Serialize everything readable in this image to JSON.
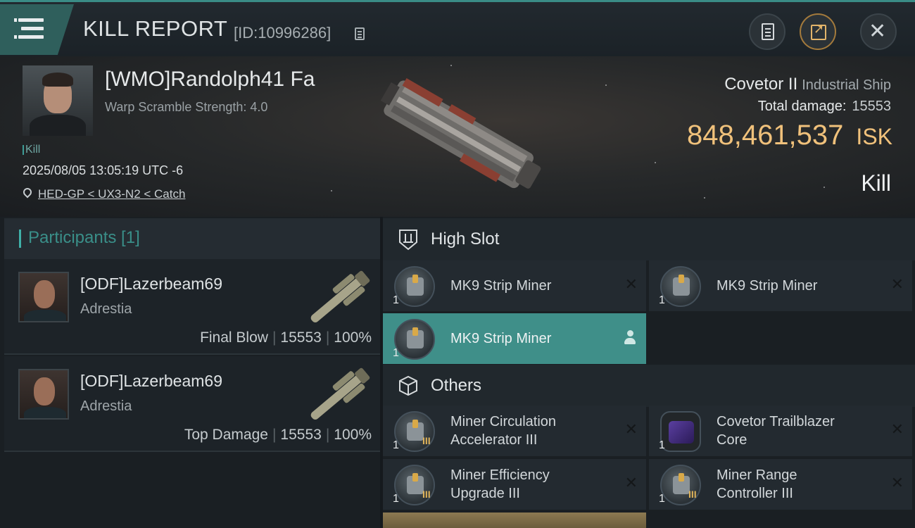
{
  "header": {
    "title": "KILL REPORT",
    "report_id": "[ID:10996286]",
    "icons": [
      "menu-icon",
      "copy-icon",
      "clipboard-icon",
      "share-icon",
      "close-icon"
    ]
  },
  "victim": {
    "name": "[WMO]Randolph41 Fa",
    "warp_scramble": "Warp Scramble Strength: 4.0",
    "tag": "Kill",
    "timestamp": "2025/08/05 13:05:19 UTC -6",
    "location": "HED-GP < UX3-N2 < Catch",
    "ship_name": "Covetor II",
    "ship_class": "Industrial Ship",
    "total_damage_label": "Total damage:",
    "total_damage": "15553",
    "isk_value": "848,461,537",
    "isk_unit": "ISK",
    "result": "Kill"
  },
  "participants": {
    "title": "Participants [1]",
    "rows": [
      {
        "name": "[ODF]Lazerbeam69",
        "ship": "Adrestia",
        "role": "Final Blow",
        "damage": "15553",
        "percent": "100%"
      },
      {
        "name": "[ODF]Lazerbeam69",
        "ship": "Adrestia",
        "role": "Top Damage",
        "damage": "15553",
        "percent": "100%"
      }
    ]
  },
  "modules": {
    "high_slot_label": "High Slot",
    "others_label": "Others",
    "high_slot": [
      {
        "qty": "1",
        "name": "MK9 Strip Miner",
        "state": "destroyed"
      },
      {
        "qty": "1",
        "name": "MK9 Strip Miner",
        "state": "destroyed"
      },
      {
        "qty": "1",
        "name": "MK9 Strip Miner",
        "state": "selected"
      }
    ],
    "others": [
      {
        "qty": "1",
        "name_line1": "Miner Circulation",
        "name_line2": "Accelerator III",
        "tier": "III",
        "state": "destroyed"
      },
      {
        "qty": "1",
        "name_line1": "Covetor Trailblazer",
        "name_line2": "Core",
        "state": "destroyed"
      },
      {
        "qty": "1",
        "name_line1": "Miner Efficiency",
        "name_line2": "Upgrade III",
        "tier": "III",
        "state": "destroyed"
      },
      {
        "qty": "1",
        "name_line1": "Miner Range",
        "name_line2": "Controller III",
        "tier": "III",
        "state": "destroyed"
      }
    ],
    "close_glyph": "✕"
  },
  "colors": {
    "accent": "#3f8f89",
    "isk": "#f0c17b",
    "panel": "#1a1f23"
  }
}
